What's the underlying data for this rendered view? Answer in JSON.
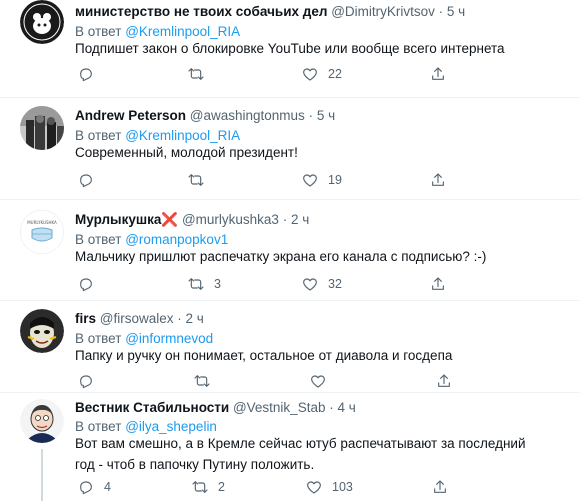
{
  "tweets": [
    {
      "name": "министерство не твоих собачьих дел",
      "handle": "@DimitryKrivtsov",
      "time": "· 5 ч",
      "reply_prefix": "В ответ",
      "reply_to": "@Kremlinpool_RIA",
      "text": "Подпишет закон о блокировке YouTube или вообще всего интернета",
      "replies": "",
      "retweets": "",
      "likes": "22",
      "avatar_icon": "dog-logo-avatar"
    },
    {
      "name": "Andrew Peterson",
      "handle": "@awashingtonmus",
      "time": "· 5 ч",
      "reply_prefix": "В ответ",
      "reply_to": "@Kremlinpool_RIA",
      "text": "Современный, молодой президент!",
      "replies": "",
      "retweets": "",
      "likes": "19",
      "avatar_icon": "photo-avatar"
    },
    {
      "name": "Мурлыкушка",
      "name_badge": "❌",
      "handle": "@murlykushka3",
      "time": "· 2 ч",
      "reply_prefix": "В ответ",
      "reply_to": "@romanpopkov1",
      "text": "Мальчику пришлют распечатку экрана его канала с подписью? :-)",
      "replies": "",
      "retweets": "3",
      "likes": "32",
      "avatar_icon": "mask-logo-avatar"
    },
    {
      "name": "firs",
      "handle": "@firsowalex",
      "time": "· 2 ч",
      "reply_prefix": "В ответ",
      "reply_to": "@informnevod",
      "text": "Папку и ручку он понимает, остальное от диавола и госдепа",
      "replies": "",
      "retweets": "",
      "likes": "",
      "avatar_icon": "masked-face-avatar"
    },
    {
      "name": "Вестник Стабильности",
      "handle": "@Vestnik_Stab",
      "time": "· 4 ч",
      "reply_prefix": "В ответ",
      "reply_to": "@ilya_shepelin",
      "text_lines": [
        "Вот вам смешно, а в Кремле сейчас ютуб распечатывают за последний",
        "год - чтоб в папочку Путину положить."
      ],
      "replies": "4",
      "retweets": "2",
      "likes": "103",
      "avatar_icon": "caricature-avatar"
    }
  ],
  "colors": {
    "accent": "#1d9bf0",
    "secondary_text": "#536471",
    "primary_text": "#0f1419",
    "divider": "#eff3f4"
  }
}
